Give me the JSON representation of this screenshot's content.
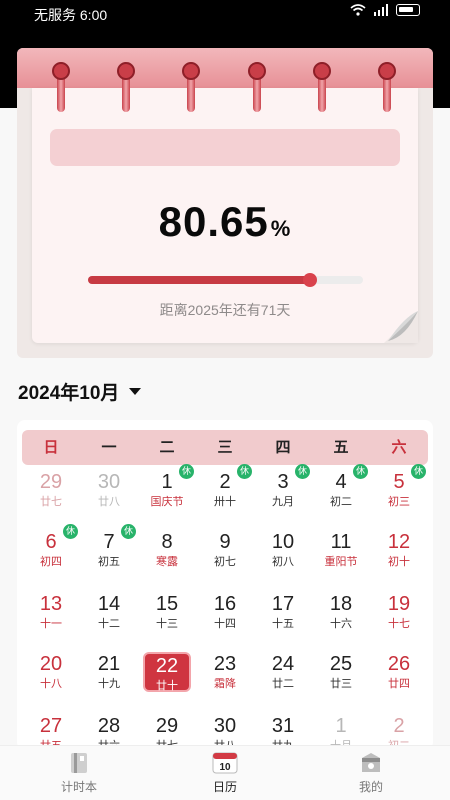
{
  "status_bar": {
    "carrier_time": "无服务 6:00"
  },
  "counter_card": {
    "percent_value": "80.65",
    "percent_sign": "%",
    "progress_fraction": 0.8065,
    "countdown_text": "距离2025年还有71天"
  },
  "calendar": {
    "month_label": "2024年10月",
    "weekdays": [
      "日",
      "一",
      "二",
      "三",
      "四",
      "五",
      "六"
    ],
    "rest_badge": "休",
    "days": [
      {
        "n": "29",
        "s": "廿七",
        "dim": true
      },
      {
        "n": "30",
        "s": "廿八",
        "dim": true
      },
      {
        "n": "1",
        "s": "国庆节",
        "rest": true,
        "fest": true
      },
      {
        "n": "2",
        "s": "卅十",
        "rest": true
      },
      {
        "n": "3",
        "s": "九月",
        "rest": true
      },
      {
        "n": "4",
        "s": "初二",
        "rest": true
      },
      {
        "n": "5",
        "s": "初三",
        "rest": true
      },
      {
        "n": "6",
        "s": "初四",
        "rest": true
      },
      {
        "n": "7",
        "s": "初五",
        "rest": true
      },
      {
        "n": "8",
        "s": "寒露",
        "fest": true
      },
      {
        "n": "9",
        "s": "初七"
      },
      {
        "n": "10",
        "s": "初八"
      },
      {
        "n": "11",
        "s": "重阳节",
        "fest": true
      },
      {
        "n": "12",
        "s": "初十"
      },
      {
        "n": "13",
        "s": "十一"
      },
      {
        "n": "14",
        "s": "十二"
      },
      {
        "n": "15",
        "s": "十三"
      },
      {
        "n": "16",
        "s": "十四"
      },
      {
        "n": "17",
        "s": "十五"
      },
      {
        "n": "18",
        "s": "十六"
      },
      {
        "n": "19",
        "s": "十七"
      },
      {
        "n": "20",
        "s": "十八"
      },
      {
        "n": "21",
        "s": "十九"
      },
      {
        "n": "22",
        "s": "廿十",
        "today": true
      },
      {
        "n": "23",
        "s": "霜降",
        "fest": true
      },
      {
        "n": "24",
        "s": "廿二"
      },
      {
        "n": "25",
        "s": "廿三"
      },
      {
        "n": "26",
        "s": "廿四"
      },
      {
        "n": "27",
        "s": "廿五"
      },
      {
        "n": "28",
        "s": "廿六"
      },
      {
        "n": "29",
        "s": "廿七"
      },
      {
        "n": "30",
        "s": "廿八"
      },
      {
        "n": "31",
        "s": "廿九"
      },
      {
        "n": "1",
        "s": "十月",
        "dim": true
      },
      {
        "n": "2",
        "s": "初二",
        "dim": true
      }
    ]
  },
  "tabs": [
    {
      "label": "计时本",
      "icon": "timer-book-icon"
    },
    {
      "label": "日历",
      "icon": "calendar-icon",
      "badge": "10",
      "active": true
    },
    {
      "label": "我的",
      "icon": "profile-icon"
    }
  ],
  "colors": {
    "accent": "#c8313c",
    "rest_badge": "#28b36a",
    "today_bg": "#cf3540"
  }
}
